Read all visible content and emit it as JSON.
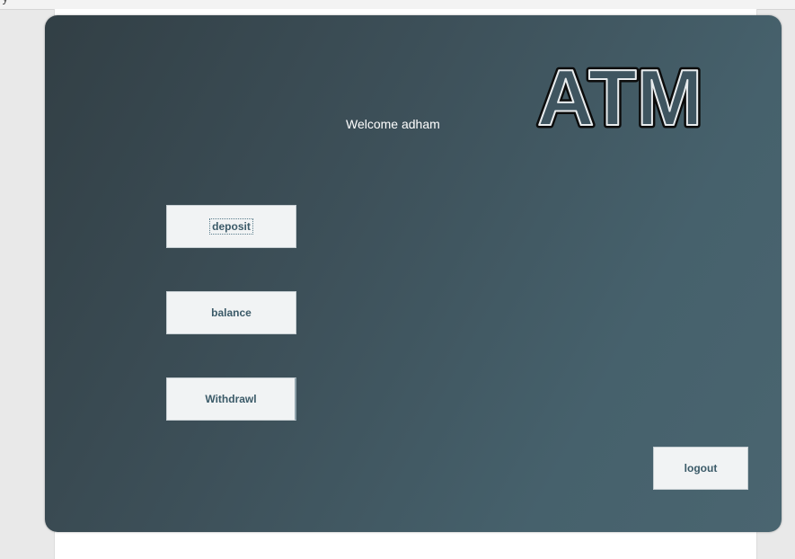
{
  "window": {
    "top_text": "y"
  },
  "welcome": {
    "text": "Welcome adham"
  },
  "logo": {
    "text": "ATM"
  },
  "buttons": {
    "deposit": "deposit",
    "balance": "balance",
    "withdraw": "Withdrawl",
    "logout": "logout"
  },
  "colors": {
    "panel_dark": "#323f45",
    "panel_light": "#4a6570",
    "button_bg": "#f1f3f4",
    "button_text": "#3b5a68",
    "welcome_text": "#ffffff"
  }
}
